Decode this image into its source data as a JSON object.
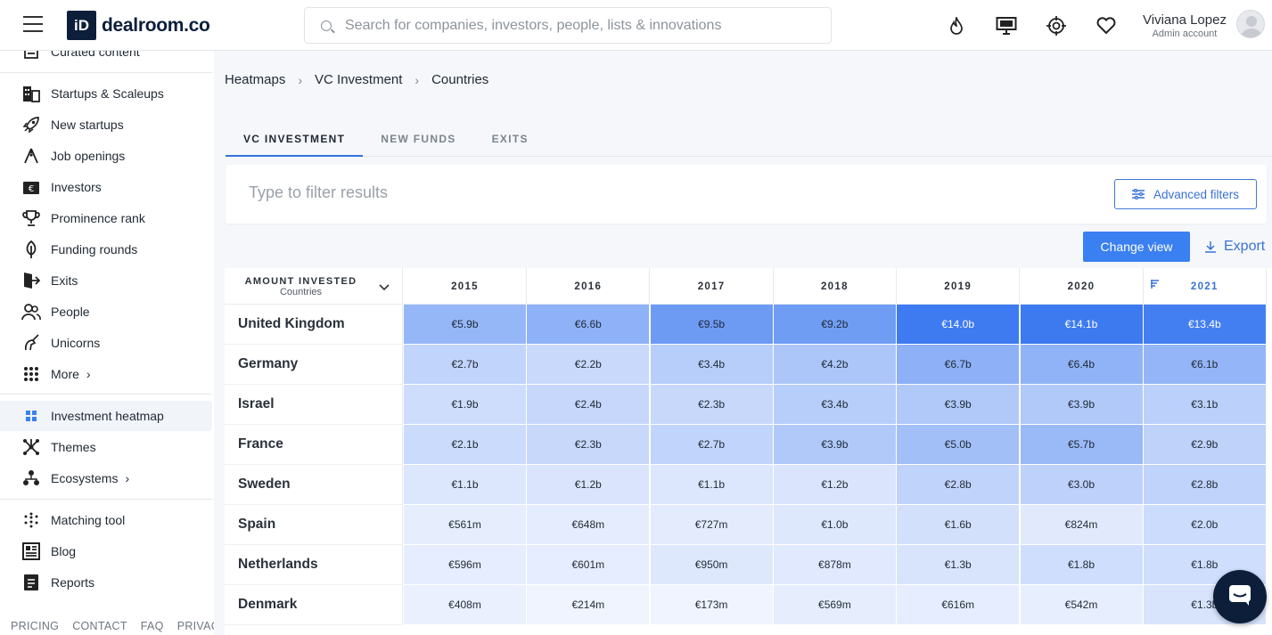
{
  "header": {
    "logo_mark": "iD",
    "logo_text": "dealroom.co",
    "search_placeholder": "Search for companies, investors, people, lists & innovations",
    "icons": [
      "fire-icon",
      "monitor-icon",
      "target-icon",
      "heart-icon"
    ],
    "user_name": "Viviana Lopez",
    "user_role": "Admin account"
  },
  "sidebar": {
    "items": [
      {
        "label": "Curated content",
        "icon": "curated-icon"
      },
      {
        "label": "Startups & Scaleups",
        "icon": "buildings-icon"
      },
      {
        "label": "New startups",
        "icon": "rocket-icon"
      },
      {
        "label": "Job openings",
        "icon": "climber-icon"
      },
      {
        "label": "Investors",
        "icon": "wallet-icon"
      },
      {
        "label": "Prominence rank",
        "icon": "trophy-icon"
      },
      {
        "label": "Funding rounds",
        "icon": "seed-icon"
      },
      {
        "label": "Exits",
        "icon": "exit-icon"
      },
      {
        "label": "People",
        "icon": "people-icon"
      },
      {
        "label": "Unicorns",
        "icon": "unicorn-icon"
      },
      {
        "label": "More",
        "icon": "grid-dots-icon"
      },
      {
        "label": "Investment heatmap",
        "icon": "heatmap-icon"
      },
      {
        "label": "Themes",
        "icon": "themes-icon"
      },
      {
        "label": "Ecosystems",
        "icon": "ecosystem-icon"
      },
      {
        "label": "Matching tool",
        "icon": "dots-icon"
      },
      {
        "label": "Blog",
        "icon": "blog-icon"
      },
      {
        "label": "Reports",
        "icon": "report-icon"
      }
    ],
    "footer": [
      "PRICING",
      "CONTACT",
      "FAQ",
      "PRIVACY"
    ]
  },
  "breadcrumb": [
    "Heatmaps",
    "VC Investment",
    "Countries"
  ],
  "tabs": [
    "VC INVESTMENT",
    "NEW FUNDS",
    "EXITS"
  ],
  "filter": {
    "placeholder": "Type to filter results",
    "advanced_label": "Advanced filters"
  },
  "actions": {
    "change_view": "Change view",
    "export": "Export"
  },
  "table": {
    "metric_label": "AMOUNT INVESTED",
    "dimension_label": "Countries",
    "years": [
      "2015",
      "2016",
      "2017",
      "2018",
      "2019",
      "2020",
      "2021"
    ],
    "sorted_year": "2021",
    "rows": [
      {
        "country": "United Kingdom",
        "values": [
          "€5.9b",
          "€6.6b",
          "€9.5b",
          "€9.2b",
          "€14.0b",
          "€14.1b",
          "€13.4b"
        ],
        "amounts_b": [
          5.9,
          6.6,
          9.5,
          9.2,
          14.0,
          14.1,
          13.4
        ]
      },
      {
        "country": "Germany",
        "values": [
          "€2.7b",
          "€2.2b",
          "€3.4b",
          "€4.2b",
          "€6.7b",
          "€6.4b",
          "€6.1b"
        ],
        "amounts_b": [
          2.7,
          2.2,
          3.4,
          4.2,
          6.7,
          6.4,
          6.1
        ]
      },
      {
        "country": "Israel",
        "values": [
          "€1.9b",
          "€2.4b",
          "€2.3b",
          "€3.4b",
          "€3.9b",
          "€3.9b",
          "€3.1b"
        ],
        "amounts_b": [
          1.9,
          2.4,
          2.3,
          3.4,
          3.9,
          3.9,
          3.1
        ]
      },
      {
        "country": "France",
        "values": [
          "€2.1b",
          "€2.3b",
          "€2.7b",
          "€3.9b",
          "€5.0b",
          "€5.7b",
          "€2.9b"
        ],
        "amounts_b": [
          2.1,
          2.3,
          2.7,
          3.9,
          5.0,
          5.7,
          2.9
        ]
      },
      {
        "country": "Sweden",
        "values": [
          "€1.1b",
          "€1.2b",
          "€1.1b",
          "€1.2b",
          "€2.8b",
          "€3.0b",
          "€2.8b"
        ],
        "amounts_b": [
          1.1,
          1.2,
          1.1,
          1.2,
          2.8,
          3.0,
          2.8
        ]
      },
      {
        "country": "Spain",
        "values": [
          "€561m",
          "€648m",
          "€727m",
          "€1.0b",
          "€1.6b",
          "€824m",
          "€2.0b"
        ],
        "amounts_b": [
          0.561,
          0.648,
          0.727,
          1.0,
          1.6,
          0.824,
          2.0
        ]
      },
      {
        "country": "Netherlands",
        "values": [
          "€596m",
          "€601m",
          "€950m",
          "€878m",
          "€1.3b",
          "€1.8b",
          "€1.8b"
        ],
        "amounts_b": [
          0.596,
          0.601,
          0.95,
          0.878,
          1.3,
          1.8,
          1.8
        ]
      },
      {
        "country": "Denmark",
        "values": [
          "€408m",
          "€214m",
          "€173m",
          "€569m",
          "€616m",
          "€542m",
          "€1.3b"
        ],
        "amounts_b": [
          0.408,
          0.214,
          0.173,
          0.569,
          0.616,
          0.542,
          1.3
        ]
      }
    ]
  },
  "colors": {
    "accent": "#3a80f0",
    "heat_max": "#3d7af0",
    "heat_min": "#f7f9ff"
  }
}
